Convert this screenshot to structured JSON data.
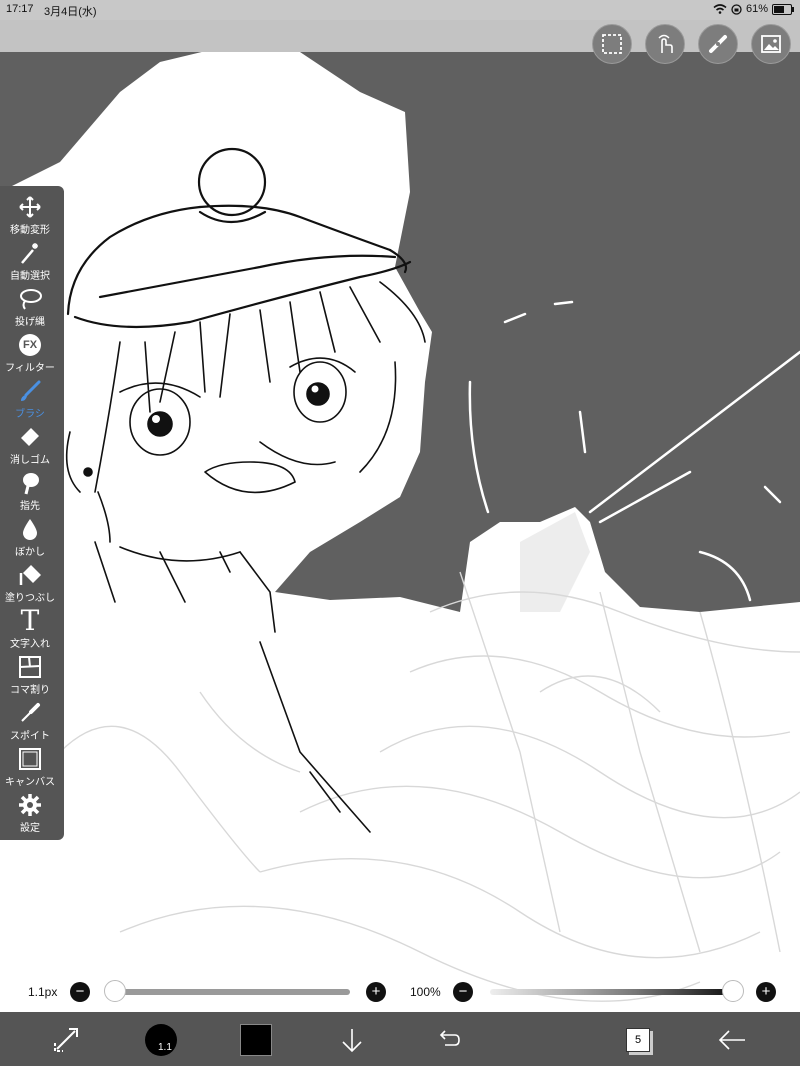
{
  "status": {
    "time": "17:17",
    "date": "3月4日(水)",
    "battery": "61%",
    "battery_level": 0.61
  },
  "top_buttons": [
    {
      "name": "selection-icon"
    },
    {
      "name": "gesture-icon"
    },
    {
      "name": "ruler-icon"
    },
    {
      "name": "image-icon"
    }
  ],
  "toolbar": {
    "items": [
      {
        "label": "移動変形",
        "icon": "move-icon"
      },
      {
        "label": "自動選択",
        "icon": "magic-wand-icon"
      },
      {
        "label": "投げ縄",
        "icon": "lasso-icon"
      },
      {
        "label": "フィルター",
        "icon": "fx-icon",
        "icon_text": "FX"
      },
      {
        "label": "ブラシ",
        "icon": "brush-icon",
        "active": true
      },
      {
        "label": "消しゴム",
        "icon": "eraser-icon"
      },
      {
        "label": "指先",
        "icon": "finger-icon"
      },
      {
        "label": "ぼかし",
        "icon": "blur-icon"
      },
      {
        "label": "塗りつぶし",
        "icon": "fill-icon"
      },
      {
        "label": "文字入れ",
        "icon": "text-icon",
        "icon_text": "T"
      },
      {
        "label": "コマ割り",
        "icon": "panel-icon"
      },
      {
        "label": "スポイト",
        "icon": "eyedropper-icon"
      },
      {
        "label": "キャンバス",
        "icon": "canvas-icon"
      },
      {
        "label": "設定",
        "icon": "gear-icon"
      }
    ],
    "active_color": "#4a90e2"
  },
  "sliders": {
    "size_label": "1.1px",
    "size_value": 0.0,
    "opacity_label": "100%",
    "opacity_value": 1.0,
    "minus": "−",
    "plus": "+"
  },
  "bottom": {
    "brush_size": "1.1",
    "color": "#000000",
    "layers_count": "5"
  }
}
